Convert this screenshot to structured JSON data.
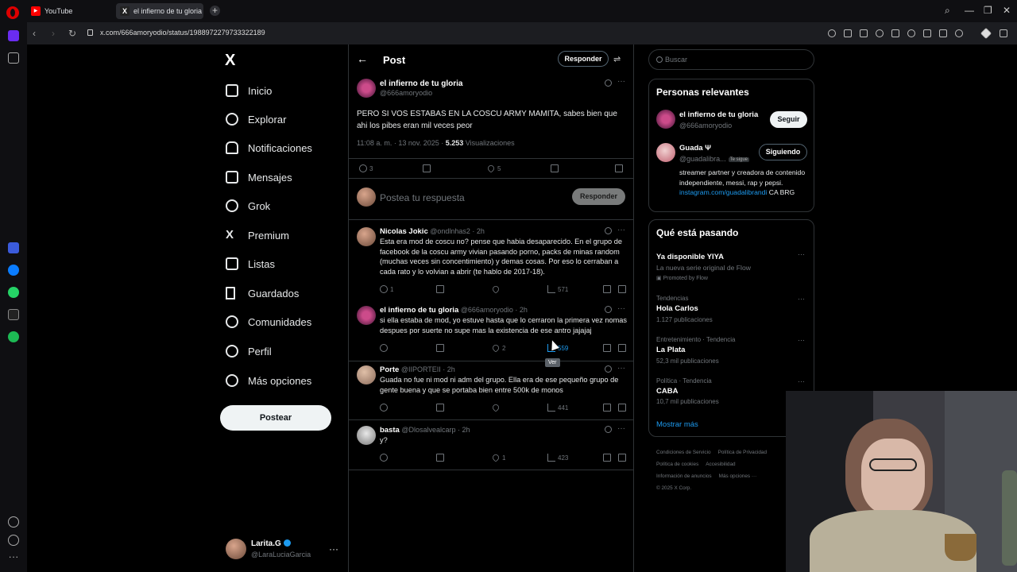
{
  "browser": {
    "tabs": [
      {
        "label": "YouTube",
        "favicon": "youtube-icon"
      },
      {
        "label": "el infierno de tu gloria en",
        "favicon": "x-icon"
      }
    ],
    "url": "x.com/666amoryodio/status/1988972279733322189"
  },
  "nav": {
    "logo": "X",
    "items": [
      {
        "label": "Inicio",
        "icon": "home-icon"
      },
      {
        "label": "Explorar",
        "icon": "search-icon"
      },
      {
        "label": "Notificaciones",
        "icon": "bell-icon"
      },
      {
        "label": "Mensajes",
        "icon": "mail-icon"
      },
      {
        "label": "Grok",
        "icon": "grok-icon"
      },
      {
        "label": "Premium",
        "icon": "x-icon"
      },
      {
        "label": "Listas",
        "icon": "list-icon"
      },
      {
        "label": "Guardados",
        "icon": "bookmark-icon"
      },
      {
        "label": "Comunidades",
        "icon": "people-icon"
      },
      {
        "label": "Perfil",
        "icon": "person-icon"
      },
      {
        "label": "Más opciones",
        "icon": "more-icon"
      }
    ],
    "post_button": "Postear",
    "account": {
      "name": "Larita.G",
      "handle": "@LaraLuciaGarcia"
    }
  },
  "header": {
    "title": "Post",
    "reply_button": "Responder"
  },
  "main_post": {
    "name": "el infierno de tu gloria",
    "handle": "@666amoryodio",
    "text": "PERO SI VOS ESTABAS EN LA COSCU ARMY MAMITA, sabes bien que ahi los pibes eran mil veces peor",
    "time": "11:08 a. m. · 13 nov. 2025 · ",
    "views": "5.253",
    "views_label": " Visualizaciones",
    "replies": "3",
    "likes": "5"
  },
  "compose": {
    "placeholder": "Postea tu respuesta",
    "button": "Responder"
  },
  "replies": [
    {
      "name": "Nicolas Jokic",
      "handle": "@ondlnhas2 · 2h",
      "text": "Esta era mod de coscu no? pense que habia desaparecido. En el grupo de facebook de la coscu army vivian pasando porno, packs de minas random (muchas veces sin concentimiento) y demas cosas. Por eso lo cerraban a cada rato y lo volvian a abrir (te hablo de 2017-18).",
      "replies": "1",
      "likes": "",
      "views": "571"
    },
    {
      "name": "el infierno de tu gloria",
      "handle": "@666amoryodio · 2h",
      "text": "si ella estaba de mod, yo estuve hasta que lo cerraron la primera vez nomas despues por suerte no supe mas la existencia de ese antro jajajaj",
      "replies": "",
      "likes": "2",
      "views": "559"
    },
    {
      "name": "Porte",
      "handle": "@IIPORTEII · 2h",
      "text": "Guada no fue ni mod ni adm del grupo. Ella era de ese pequeño grupo de gente buena y que se portaba bien entre 500k de monos",
      "replies": "",
      "likes": "",
      "views": "441"
    },
    {
      "name": "basta",
      "handle": "@Dlosalvealcarp · 2h",
      "text": "y?",
      "replies": "",
      "likes": "1",
      "views": "423"
    }
  ],
  "tooltip": "Ver",
  "sidebar": {
    "search_placeholder": "Buscar",
    "relevant_title": "Personas relevantes",
    "people": [
      {
        "name": "el infierno de tu gloria",
        "handle": "@666amoryodio",
        "button": "Seguir"
      },
      {
        "name": "Guada Ψ",
        "handle": "@guadalibra...",
        "badge": "Te sigue",
        "button": "Siguiendo",
        "bio": "streamer partner y creadora de contenido independiente, messi, rap y pepsi. ",
        "bio_link": "instagram.com/guadalibrandi",
        "bio_end": " CA BRG"
      }
    ],
    "trends_title": "Qué está pasando",
    "trends": [
      {
        "category": "",
        "name": "Ya disponible YIYA",
        "count": "La nueva serie original de Flow",
        "promo": "Promoted by Flow"
      },
      {
        "category": "Tendencias",
        "name": "Hola Carlos",
        "count": "1.127 publicaciones"
      },
      {
        "category": "Entretenimiento · Tendencia",
        "name": "La Plata",
        "count": "52,3 mil publicaciones"
      },
      {
        "category": "Política · Tendencia",
        "name": "CABA",
        "count": "10,7 mil publicaciones"
      }
    ],
    "show_more": "Mostrar más",
    "footer": [
      "Condiciones de Servicio",
      "Política de Privacidad",
      "Política de cookies",
      "Accesibilidad",
      "Información de anuncios",
      "Más opciones ···",
      "© 2025 X Corp."
    ]
  }
}
